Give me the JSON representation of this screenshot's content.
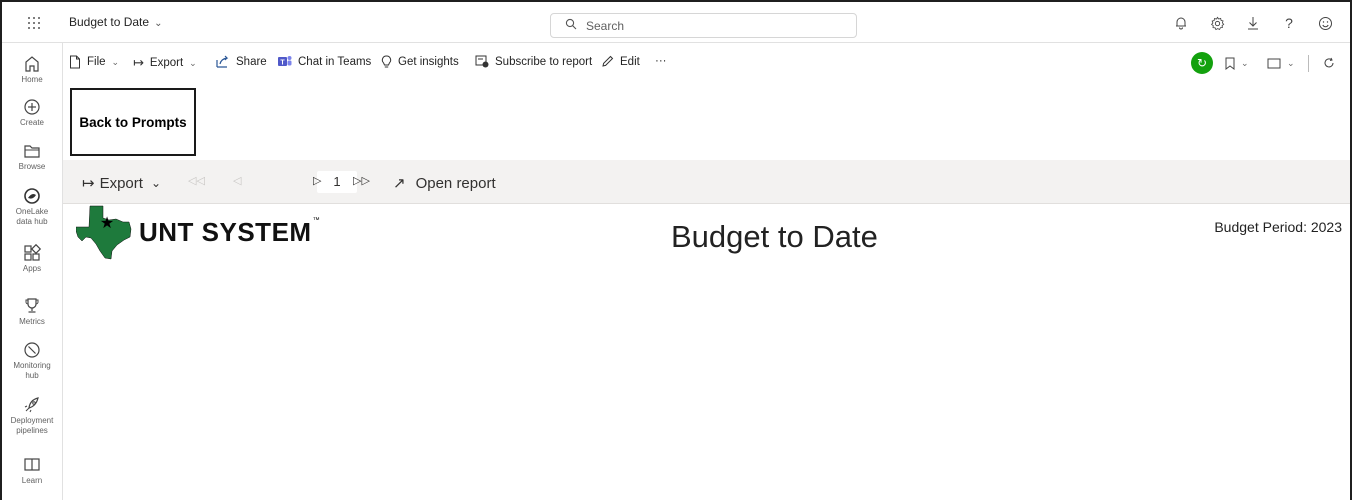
{
  "topbar": {
    "report_title": "Budget to Date",
    "search_placeholder": "Search"
  },
  "leftnav": {
    "items": [
      {
        "label": "Home",
        "icon": "home-icon"
      },
      {
        "label": "Create",
        "icon": "plus-circle-icon"
      },
      {
        "label": "Browse",
        "icon": "folder-icon"
      },
      {
        "label_line1": "OneLake",
        "label_line2": "data hub",
        "icon": "onelake-icon"
      },
      {
        "label": "Apps",
        "icon": "apps-icon"
      },
      {
        "label": "Metrics",
        "icon": "trophy-icon"
      },
      {
        "label_line1": "Monitoring",
        "label_line2": "hub",
        "icon": "monitor-icon"
      },
      {
        "label_line1": "Deployment",
        "label_line2": "pipelines",
        "icon": "rocket-icon"
      },
      {
        "label": "Learn",
        "icon": "book-icon"
      }
    ]
  },
  "commandbar": {
    "file": "File",
    "export": "Export",
    "share": "Share",
    "chat_in_teams": "Chat in Teams",
    "get_insights": "Get insights",
    "subscribe": "Subscribe to report",
    "edit": "Edit",
    "more": "···"
  },
  "report": {
    "back_button": "Back to Prompts",
    "toolbar": {
      "export": "Export",
      "page_number": "1",
      "open_report": "Open report"
    },
    "logo_text": "UNT SYSTEM",
    "logo_tm": "™",
    "title": "Budget to Date",
    "budget_period": "Budget Period: 2023"
  },
  "colors": {
    "logo_green": "#1e7a3c",
    "status_green": "#13a10e"
  }
}
